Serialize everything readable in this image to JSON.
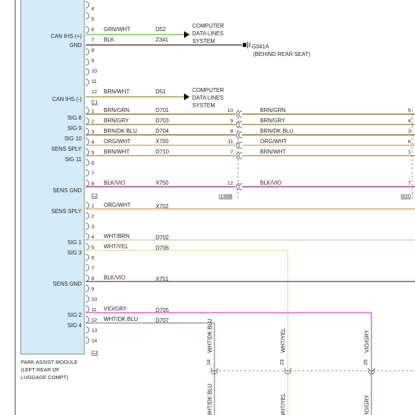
{
  "module": {
    "label_lines": [
      "PARK ASSIST MODULE",
      "(LEFT REAR OF",
      "LUGGAGE COMPT)"
    ]
  },
  "colors": {
    "module_fill": "#d4ecf7",
    "module_stroke": "#6a8a9a",
    "GRN/WHT": "#6ec94a",
    "BLK": "#1a1a1a",
    "BRN/WHT": "#b59a3a",
    "BRN/GRN": "#8a7a2a",
    "BRN/GRY": "#9a8a50",
    "BRN/DK BLU": "#8a6a2a",
    "ORG/WHT": "#f0a050",
    "BLK/VIO": "#9a3a9a",
    "WHT/BRN": "#d8c8b8",
    "WHT/YEL": "#ece2a0",
    "VIO/GRY": "#e060e0",
    "WHT/DK BLU": "#8a9ab8"
  },
  "connectors": {
    "upper": {
      "name": "C1",
      "pins": [
        {
          "num": "4"
        },
        {
          "num": "5"
        },
        {
          "num": "6",
          "side": "CAN IHS (+)",
          "color": "GRN/WHT",
          "circuit": "D52",
          "target": "COMPUTER DATA LINES SYSTEM"
        },
        {
          "num": "7",
          "side": "GND",
          "color": "BLK",
          "circuit": "Z341",
          "target": "G041A"
        },
        {
          "num": "8"
        },
        {
          "num": "9"
        },
        {
          "num": "10"
        },
        {
          "num": "11"
        },
        {
          "num": "12",
          "side": "CAN IHS (-)",
          "color": "BRN/WHT",
          "circuit": "D51",
          "target": "COMPUTER DATA LINES SYSTEM"
        }
      ]
    },
    "c2": {
      "name": "C2",
      "pins": [
        {
          "num": "1",
          "side": "SIG 8",
          "color": "BRN/GRN",
          "circuit": "D701",
          "inline": "10",
          "far_color": "BRN/GRN",
          "far_pin": "5"
        },
        {
          "num": "2",
          "side": "SIG 9",
          "color": "BRN/GRY",
          "circuit": "D703",
          "inline": "9",
          "far_color": "BRN/GRY",
          "far_pin": "4"
        },
        {
          "num": "3",
          "side": "SIG 10",
          "color": "BRN/DK BLU",
          "circuit": "D704",
          "inline": "8",
          "far_color": "BRN/DK BLU",
          "far_pin": "3"
        },
        {
          "num": "4",
          "side": "SENS SPLY",
          "color": "ORG/WHT",
          "circuit": "X700",
          "inline": "11",
          "far_color": "ORG/WHT",
          "far_pin": "6"
        },
        {
          "num": "5",
          "side": "SIG 11",
          "color": "BRN/WHT",
          "circuit": "D710",
          "inline": "7",
          "far_color": "BRN/WHT",
          "far_pin": "1"
        },
        {
          "num": "6"
        },
        {
          "num": "7"
        },
        {
          "num": "8",
          "side": "SENS GND",
          "color": "BLK/VIO",
          "circuit": "X750",
          "inline": "12",
          "far_color": "BLK/VIO",
          "far_pin": "7"
        }
      ],
      "inline_connector": "I196B",
      "far_connector": "I020"
    },
    "c3": {
      "name": "C3",
      "pins": [
        {
          "num": "1",
          "side": "SENS SPLY",
          "color": "ORG/WHT",
          "circuit": "X702"
        },
        {
          "num": "2"
        },
        {
          "num": "3"
        },
        {
          "num": "4",
          "side": "SIG 1",
          "color": "WHT/BRN",
          "circuit": "D702"
        },
        {
          "num": "5",
          "side": "SIG 3",
          "color": "WHT/YEL",
          "circuit": "D706"
        },
        {
          "num": "6"
        },
        {
          "num": "7"
        },
        {
          "num": "8",
          "side": "SENS GND",
          "color": "BLK/VIO",
          "circuit": "X751"
        },
        {
          "num": "9"
        },
        {
          "num": "10"
        },
        {
          "num": "11",
          "side": "SIG 2",
          "color": "VIO/GRY",
          "circuit": "D705"
        },
        {
          "num": "12",
          "side": "SIG 4",
          "color": "WHT/DK BLU",
          "circuit": "D707"
        },
        {
          "num": "13"
        },
        {
          "num": "14"
        }
      ]
    }
  },
  "ground": {
    "name": "G041A",
    "note": "(BEHIND REAR SEAT)"
  },
  "vertical_runs": [
    {
      "pin": "24",
      "label": "WHT/DK BLU",
      "label_visible": "WHT/DK BLU",
      "color": "WHT/DK BLU"
    },
    {
      "pin": "23",
      "label": "WHT/YEL",
      "label_visible": "WHT/YEL",
      "color": "WHT/YEL"
    },
    {
      "pin": "25",
      "label": "VIO/GRY",
      "label_visible": "VIO/GRY",
      "color": "VIO/GRY"
    }
  ],
  "vertical_bottom_labels": [
    "WHT/DK BLU",
    "WHT/YEL",
    "VIO/GRY"
  ]
}
